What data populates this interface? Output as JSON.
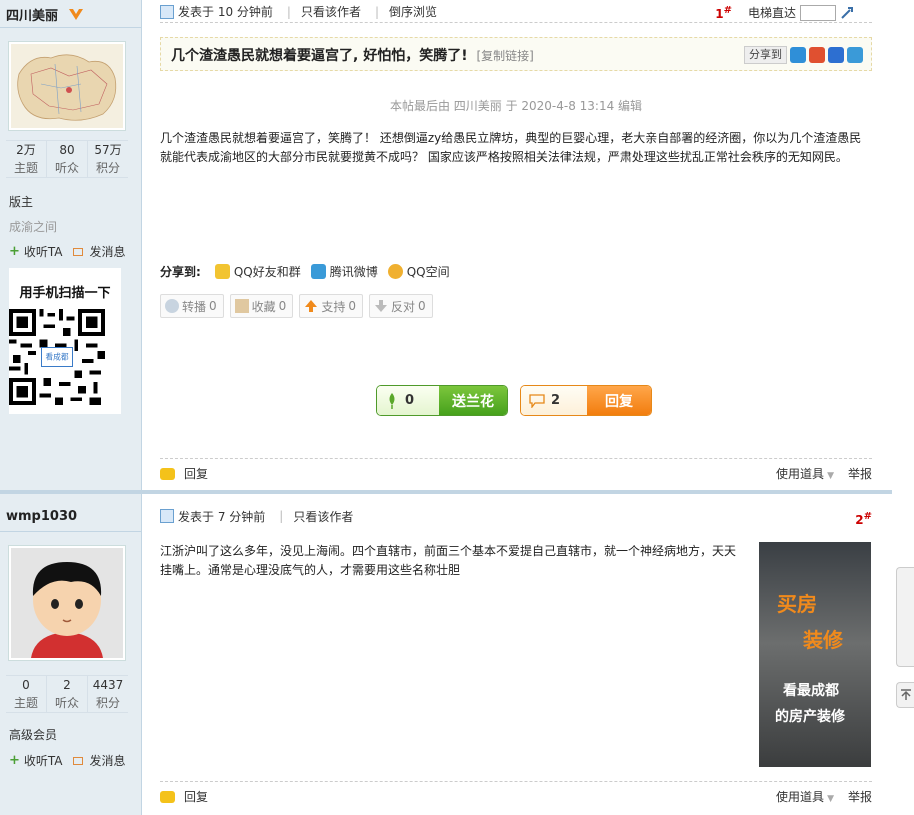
{
  "post1": {
    "author": "四川美丽",
    "stats": [
      {
        "value": "2万",
        "label": "主题"
      },
      {
        "value": "80",
        "label": "听众"
      },
      {
        "value": "57万",
        "label": "积分"
      }
    ],
    "rank": "版主",
    "forum": "成渝之间",
    "follow": "收听TA",
    "message": "发消息",
    "qr_title": "用手机扫描一下",
    "posted": "发表于 10 分钟前",
    "only_author": "只看该作者",
    "reverse": "倒序浏览",
    "floor": "1",
    "floor_mark": "#",
    "elevator": "电梯直达",
    "thread_title": "几个渣渣愚民就想着要逼宫了, 好怕怕，笑腾了!",
    "copy_link": "[复制链接]",
    "share_to": "分享到",
    "edited_note": "本帖最后由 四川美丽 于 2020-4-8 13:14 编辑",
    "body": "几个渣渣愚民就想着要逼宫了，笑腾了！ 还想倒逼zy给愚民立牌坊，典型的巨婴心理，老大亲自部署的经济圈，你以为几个渣渣愚民就能代表成渝地区的大部分市民就要搅黄不成吗？ 国家应该严格按照相关法律法规，严肃处理这些扰乱正常社会秩序的无知网民。",
    "share_label": "分享到:",
    "share_targets": [
      "QQ好友和群",
      "腾讯微博",
      "QQ空间"
    ],
    "actions": [
      "转播",
      "收藏",
      "支持",
      "反对"
    ],
    "action_counts": [
      "0",
      "0",
      "0",
      "0"
    ],
    "flower_count": "0",
    "flower_label": "送兰花",
    "reply_count": "2",
    "reply_label": "回复",
    "foot_reply": "回复",
    "tools": "使用道具",
    "report": "举报"
  },
  "post2": {
    "author": "wmp1030",
    "stats": [
      {
        "value": "0",
        "label": "主题"
      },
      {
        "value": "2",
        "label": "听众"
      },
      {
        "value": "4437",
        "label": "积分"
      }
    ],
    "rank": "高级会员",
    "follow": "收听TA",
    "message": "发消息",
    "posted": "发表于 7 分钟前",
    "only_author": "只看该作者",
    "floor": "2",
    "floor_mark": "#",
    "body": "江浙沪叫了这么多年，没见上海闹。四个直辖市，前面三个基本不爱提自己直辖市，就一个神经病地方，天天挂嘴上。通常是心理没底气的人，才需要用这些名称壮胆",
    "foot_reply": "回复",
    "tools": "使用道具",
    "report": "举报",
    "ad": {
      "line1": "买房",
      "line2": "装修",
      "line3": "看最成都",
      "line4": "的房产装修"
    }
  },
  "qr_logo_text": "看成都"
}
